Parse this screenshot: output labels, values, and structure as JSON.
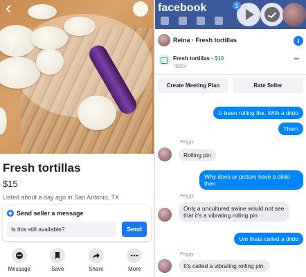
{
  "marketplace": {
    "title": "Fresh tortillas",
    "price": "$15",
    "listed": "Listed about a day ago in San Antonio, TX",
    "send_header": "Send seller a message",
    "send_input_value": "Is this still available?",
    "send_button": "Send",
    "actions": [
      {
        "label": "Message",
        "icon": "messenger-icon"
      },
      {
        "label": "Save",
        "icon": "bookmark-icon"
      },
      {
        "label": "Share",
        "icon": "share-arrow-icon"
      },
      {
        "label": "More",
        "icon": "more-dots-icon"
      }
    ]
  },
  "facebook": {
    "logo": "facebook",
    "notification_count": "1"
  },
  "chat": {
    "title": "Reina · Fresh tortillas",
    "listing_title": "Fresh tortillas",
    "listing_price": "$10",
    "listing_sub": "78254",
    "buttons": [
      "Create Meeting Plan",
      "Rate Seller"
    ],
    "messages": [
      {
        "from": "me",
        "text": "U been rolling the. With a dildo"
      },
      {
        "from": "me",
        "text": "Them"
      },
      {
        "from": "Peggy",
        "text": "Rolling pin"
      },
      {
        "from": "me",
        "text": "Why does ur picture have a dildo then"
      },
      {
        "from": "Peggy",
        "text": "Only a uncultured swine would not see that it's a vibrating rolling pin"
      },
      {
        "from": "me",
        "text": "Um thats called a dildo"
      },
      {
        "from": "Peggy",
        "text": "It's called a vibrating rolling pin."
      }
    ]
  }
}
